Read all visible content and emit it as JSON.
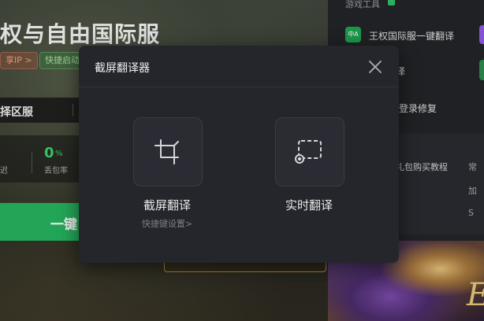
{
  "background_app": {
    "title": "权与自由国际服",
    "ip_pill": "享IP >",
    "start_pill": "快捷启动",
    "region_label": "择区服",
    "stats": {
      "delay_label": "迟",
      "loss_value": "0",
      "loss_unit": "%",
      "loss_label": "丢包率"
    },
    "boost_button": "一键",
    "tools": {
      "section_title": "游戏工具",
      "items": [
        {
          "icon_text": "中A",
          "label": "王权国际服一键翻译"
        },
        {
          "label": "译"
        },
        {
          "label": "登录修复"
        }
      ]
    },
    "tutorials": {
      "item": "礼包购买教程",
      "right_1": "常",
      "right_2": "加",
      "right_3": "S"
    },
    "banner_letter": "E"
  },
  "dialog": {
    "title": "截屏翻译器",
    "options": [
      {
        "label": "截屏翻译",
        "icon": "crop-icon"
      },
      {
        "label": "实时翻译",
        "icon": "capture-region-icon"
      }
    ],
    "shortcut_link": "快捷键设置>",
    "close_icon": "close-icon"
  },
  "colors": {
    "accent_green": "#27b35f",
    "dialog_bg": "#25262c",
    "card_bg": "#2b2c33"
  }
}
